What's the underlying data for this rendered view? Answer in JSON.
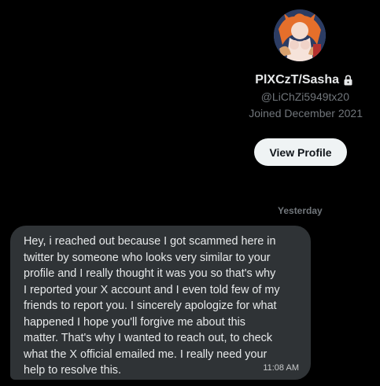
{
  "profile": {
    "display_name": "PlXCzT/Sasha",
    "handle": "@LiChZi5949tx20",
    "joined": "Joined December 2021",
    "view_profile_label": "View Profile",
    "lock_icon": "lock-icon",
    "avatar_icon": "avatar"
  },
  "conversation": {
    "date_divider": "Yesterday",
    "messages": [
      {
        "text": "Hey, i reached out because I got scammed here in\ntwitter by someone who looks very similar to your\nprofile and I really thought it was you so that's why\nI reported your X account and I even told few of my\nfriends to report you. I sincerely apologize for what\nhappened I hope you'll forgive me about this\nmatter. That's why I wanted to reach out, to check\nwhat the X official emailed me. I really need your\nhelp to resolve this.",
        "time": "11:08 AM"
      }
    ]
  },
  "colors": {
    "background": "#000000",
    "primary_text": "#e7e9ea",
    "secondary_text": "#71767b",
    "bubble": "#2f3336",
    "button_bg": "#eff3f4",
    "button_text": "#0f1419"
  }
}
